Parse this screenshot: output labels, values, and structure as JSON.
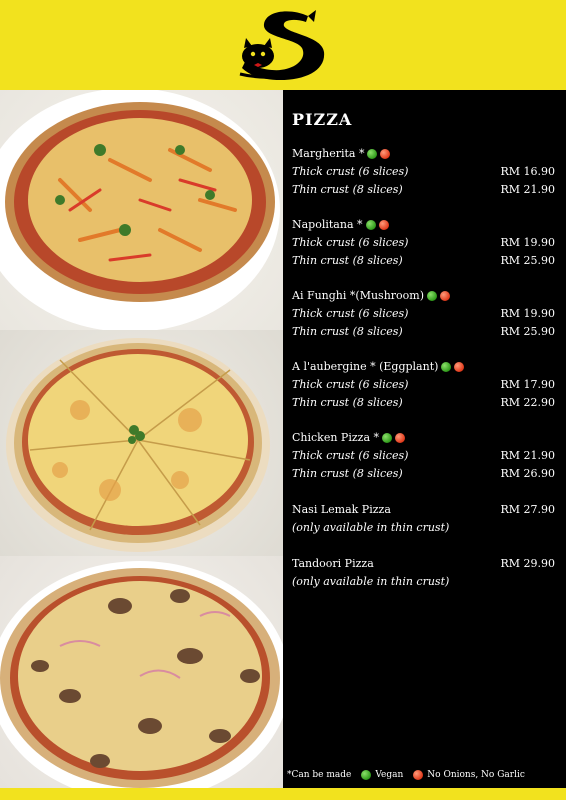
{
  "brand": {
    "logo_icon": "cat-s-logo"
  },
  "menu": {
    "section_title": "PIZZA",
    "items": [
      {
        "name": "Margherita",
        "mark": "*",
        "vegan": true,
        "no_onion_garlic": true,
        "options": [
          {
            "label": "Thick crust (6 slices)",
            "price": "RM 16.90"
          },
          {
            "label": "Thin crust (8 slices)",
            "price": "RM 21.90"
          }
        ]
      },
      {
        "name": "Napolitana",
        "mark": "*",
        "vegan": true,
        "no_onion_garlic": true,
        "options": [
          {
            "label": "Thick crust (6 slices)",
            "price": "RM 19.90"
          },
          {
            "label": "Thin crust (8 slices)",
            "price": "RM 25.90"
          }
        ]
      },
      {
        "name": "Ai Funghi",
        "mark": "*(Mushroom)",
        "vegan": true,
        "no_onion_garlic": true,
        "options": [
          {
            "label": "Thick crust (6 slices)",
            "price": "RM 19.90"
          },
          {
            "label": "Thin crust (8 slices)",
            "price": "RM 25.90"
          }
        ]
      },
      {
        "name": "A l'aubergine",
        "mark": "* (Eggplant)",
        "vegan": true,
        "no_onion_garlic": true,
        "options": [
          {
            "label": "Thick crust (6 slices)",
            "price": "RM 17.90"
          },
          {
            "label": "Thin crust (8 slices)",
            "price": "RM 22.90"
          }
        ]
      },
      {
        "name": "Chicken Pizza",
        "mark": "*",
        "vegan": true,
        "no_onion_garlic": true,
        "options": [
          {
            "label": "Thick crust (6 slices)",
            "price": "RM 21.90"
          },
          {
            "label": "Thin crust (8 slices)",
            "price": "RM 26.90"
          }
        ]
      },
      {
        "name": "Nasi Lemak Pizza",
        "price": "RM 27.90",
        "note": "(only available in thin crust)"
      },
      {
        "name": "Tandoori Pizza",
        "price": "RM 29.90",
        "note": "(only available in thin crust)"
      }
    ]
  },
  "legend": {
    "can_be_made": "*Can be made",
    "vegan": "Vegan",
    "no_onion_garlic": "No Onions, No Garlic"
  },
  "colors": {
    "background": "#f2e21e",
    "panel": "#000000",
    "vegan_dot": "#3aa823",
    "no_onion_dot": "#e8431f"
  }
}
